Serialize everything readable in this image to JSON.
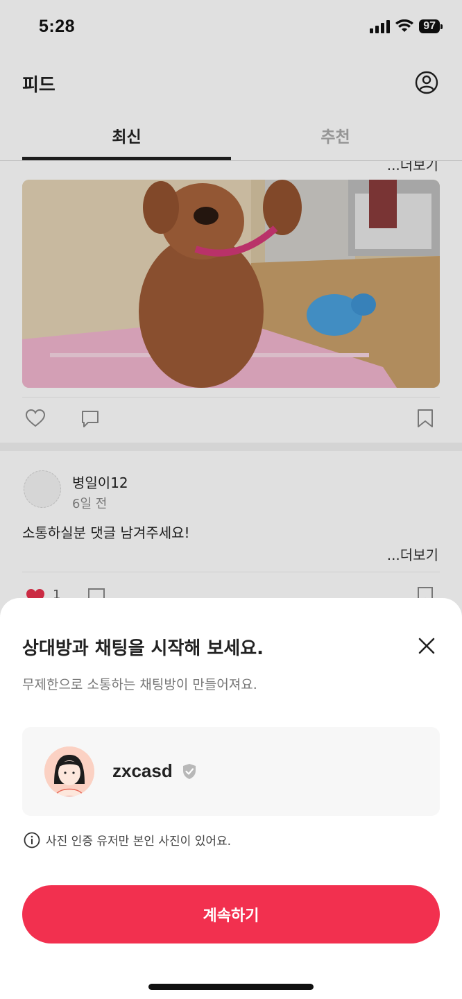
{
  "status_bar": {
    "time": "5:28",
    "battery": "97"
  },
  "header": {
    "title": "피드",
    "profile_icon": "person-circle-icon"
  },
  "tabs": [
    {
      "label": "최신",
      "active": true
    },
    {
      "label": "추천",
      "active": false
    }
  ],
  "feed": {
    "post1": {
      "more_label": "...더보기"
    },
    "post2": {
      "author": "병일이12",
      "time": "6일 전",
      "text": "소통하실분 댓글 남겨주세요!",
      "more_label": "...더보기",
      "like_count": "1"
    }
  },
  "sheet": {
    "title": "상대방과 채팅을 시작해 보세요.",
    "subtitle": "무제한으로 소통하는 채팅방이 만들어져요.",
    "user": {
      "name": "zxcasd",
      "verified_icon": "verified-shield-icon"
    },
    "notice": "사진 인증 유저만 본인 사진이 있어요.",
    "button_label": "계속하기"
  },
  "colors": {
    "accent": "#f2304f",
    "like": "#e8314d"
  }
}
